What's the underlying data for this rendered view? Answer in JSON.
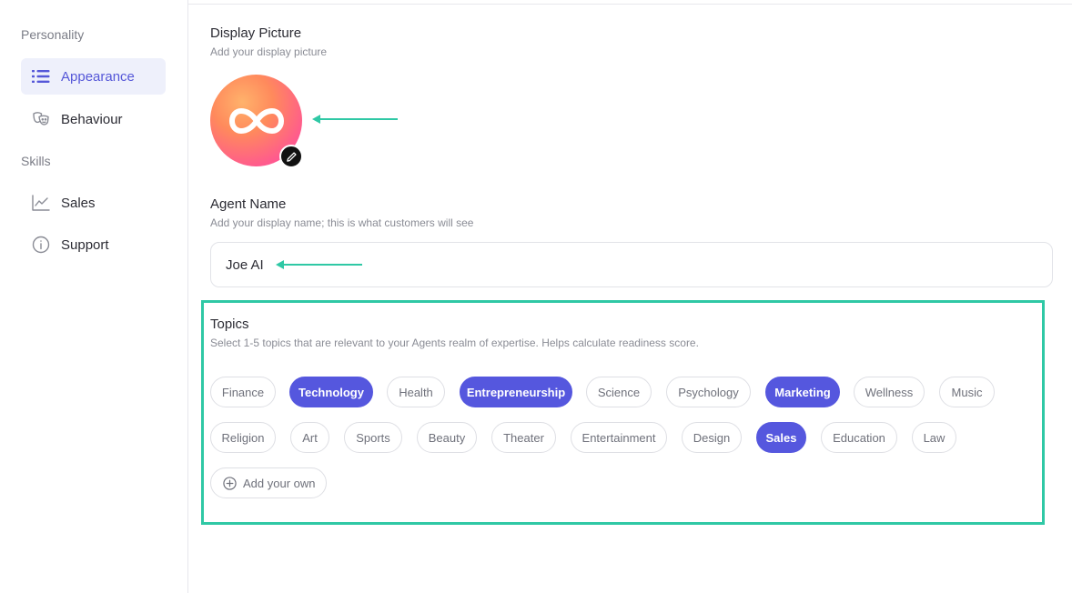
{
  "sidebar": {
    "section_personality": "Personality",
    "section_skills": "Skills",
    "items": [
      {
        "label": "Appearance",
        "icon": "list-icon"
      },
      {
        "label": "Behaviour",
        "icon": "masks-icon"
      },
      {
        "label": "Sales",
        "icon": "chart-line-icon"
      },
      {
        "label": "Support",
        "icon": "info-icon"
      }
    ]
  },
  "display_picture": {
    "title": "Display Picture",
    "subtitle": "Add your display picture"
  },
  "agent_name": {
    "title": "Agent Name",
    "subtitle": "Add your display name; this is what customers will see",
    "value": "Joe AI"
  },
  "topics": {
    "title": "Topics",
    "subtitle": "Select 1-5 topics that are relevant to your Agents realm of expertise. Helps calculate readiness score.",
    "chips": [
      {
        "label": "Finance",
        "selected": false
      },
      {
        "label": "Technology",
        "selected": true
      },
      {
        "label": "Health",
        "selected": false
      },
      {
        "label": "Entrepreneurship",
        "selected": true
      },
      {
        "label": "Science",
        "selected": false
      },
      {
        "label": "Psychology",
        "selected": false
      },
      {
        "label": "Marketing",
        "selected": true
      },
      {
        "label": "Wellness",
        "selected": false
      },
      {
        "label": "Music",
        "selected": false
      },
      {
        "label": "Religion",
        "selected": false
      },
      {
        "label": "Art",
        "selected": false
      },
      {
        "label": "Sports",
        "selected": false
      },
      {
        "label": "Beauty",
        "selected": false
      },
      {
        "label": "Theater",
        "selected": false
      },
      {
        "label": "Entertainment",
        "selected": false
      },
      {
        "label": "Design",
        "selected": false
      },
      {
        "label": "Sales",
        "selected": true
      },
      {
        "label": "Education",
        "selected": false
      },
      {
        "label": "Law",
        "selected": false
      }
    ],
    "add_label": "Add your own"
  },
  "colors": {
    "accent": "#5557de",
    "annotation": "#2fc8a5"
  }
}
